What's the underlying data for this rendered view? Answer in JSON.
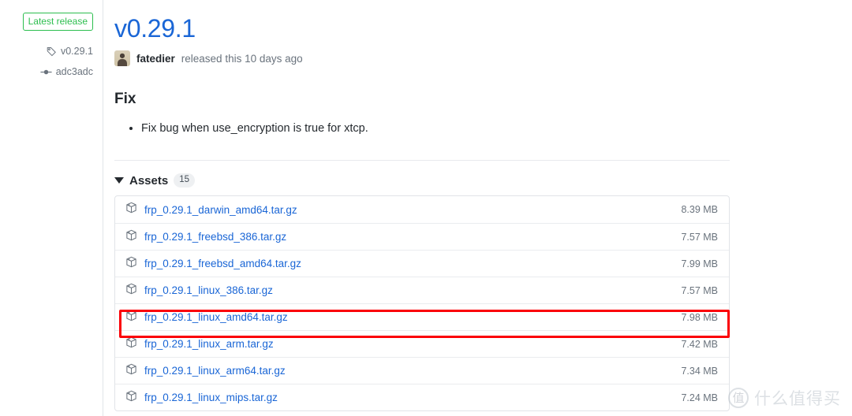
{
  "sidebar": {
    "badge_label": "Latest release",
    "badge_color": "#2cbe4e",
    "tag": {
      "icon": "tag-icon",
      "label": "v0.29.1"
    },
    "commit": {
      "icon": "commit-icon",
      "label": "adc3adc"
    }
  },
  "release": {
    "title": "v0.29.1",
    "title_color": "#1a66d6",
    "author": "fatedier",
    "byline_text": "released this 10 days ago",
    "notes_heading": "Fix",
    "notes": [
      "Fix bug when use_encryption is true for xtcp."
    ]
  },
  "assets": {
    "caret_icon": "caret-down-icon",
    "label": "Assets",
    "count": "15",
    "highlight_color": "#fb0007",
    "highlighted_index": 4,
    "rows": [
      {
        "icon": "package-icon",
        "name": "frp_0.29.1_darwin_amd64.tar.gz",
        "size": "8.39 MB"
      },
      {
        "icon": "package-icon",
        "name": "frp_0.29.1_freebsd_386.tar.gz",
        "size": "7.57 MB"
      },
      {
        "icon": "package-icon",
        "name": "frp_0.29.1_freebsd_amd64.tar.gz",
        "size": "7.99 MB"
      },
      {
        "icon": "package-icon",
        "name": "frp_0.29.1_linux_386.tar.gz",
        "size": "7.57 MB"
      },
      {
        "icon": "package-icon",
        "name": "frp_0.29.1_linux_amd64.tar.gz",
        "size": "7.98 MB"
      },
      {
        "icon": "package-icon",
        "name": "frp_0.29.1_linux_arm.tar.gz",
        "size": "7.42 MB"
      },
      {
        "icon": "package-icon",
        "name": "frp_0.29.1_linux_arm64.tar.gz",
        "size": "7.34 MB"
      },
      {
        "icon": "package-icon",
        "name": "frp_0.29.1_linux_mips.tar.gz",
        "size": "7.24 MB"
      }
    ]
  },
  "watermark": {
    "logo_char": "值",
    "text": "什么值得买"
  }
}
